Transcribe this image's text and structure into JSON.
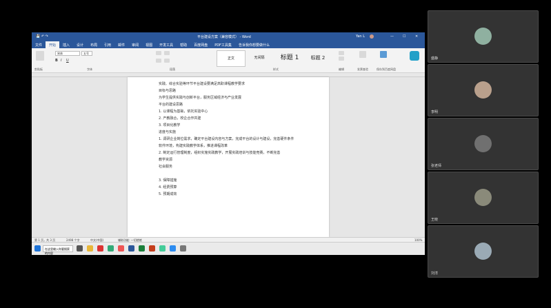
{
  "word": {
    "doc_title": "平台建设方案（兼容模式） - Word",
    "user_name": "Yan L",
    "tabs": [
      "文件",
      "开始",
      "插入",
      "设计",
      "布局",
      "引用",
      "邮件",
      "审阅",
      "视图",
      "开发工具",
      "帮助",
      "百度网盘",
      "PDF工具集",
      "告诉我你想要做什么"
    ],
    "active_tab": "开始",
    "font_name": "宋体",
    "font_size": "五号",
    "styles": [
      "正文",
      "无间隔",
      "标题 1",
      "标题 2"
    ],
    "groups": [
      "剪贴板",
      "字体",
      "段落",
      "样式",
      "编辑",
      "发票查验",
      "保存到百度网盘"
    ],
    "doc_lines": [
      "实践、综合实验等环节平台建设要满足高职课程教学要求",
      "目标与思路",
      "为学生提供实践与创新平台，服务区域经济与产业发展",
      "平台的建设思路",
      "1. 以课程为基础，依托实验中心",
      "2. 产教融合，校企合作共建",
      "3. 项目化教学",
      "进度与实施",
      "1. 调研企业岗位需求，确定平台建设内容与方案，完成平台的设计与建设，完善硬件条件",
      "软件环境，构建实践教学体系，推进课程改革",
      "2. 制定运行管理制度，组织实施实践教学，开展实践培训与技能竞赛，不断完善",
      "教学资源",
      "社会服务",
      "",
      "3. 保障措施",
      "4. 经费预算",
      "5. 预期成效"
    ],
    "status": {
      "page": "第 1 页，共 3 页",
      "words": "2498 个字",
      "lang": "中文(中国)",
      "accessibility": "辅助功能: 一切就绪",
      "zoom": "100%"
    },
    "taskbar_search": "在这里输入你要搜索的内容"
  },
  "participants": [
    {
      "name": "盛静",
      "color": "#8fb0a0"
    },
    {
      "name": "李明",
      "color": "#b9a08c"
    },
    {
      "name": "张老师",
      "color": "#707070"
    },
    {
      "name": "王晓",
      "color": "#8a8a7a"
    },
    {
      "name": "刘洋",
      "color": "#9aaab5"
    }
  ]
}
